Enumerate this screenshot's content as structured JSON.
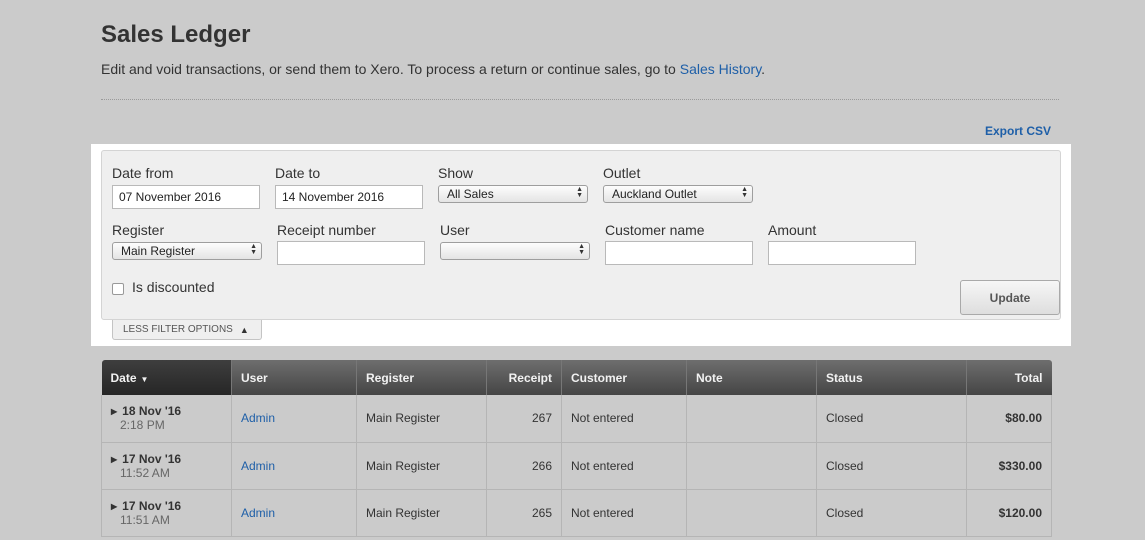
{
  "header": {
    "title": "Sales Ledger",
    "subtitle_text": "Edit and void transactions, or send them to Xero. To process a return or continue sales, go to ",
    "subtitle_link": "Sales History",
    "subtitle_end": "."
  },
  "export_csv": "Export CSV",
  "filters": {
    "date_from": {
      "label": "Date from",
      "value": "07 November 2016"
    },
    "date_to": {
      "label": "Date to",
      "value": "14 November 2016"
    },
    "show": {
      "label": "Show",
      "value": "All Sales"
    },
    "outlet": {
      "label": "Outlet",
      "value": "Auckland Outlet"
    },
    "register": {
      "label": "Register",
      "value": "Main Register"
    },
    "receipt_number": {
      "label": "Receipt number",
      "value": ""
    },
    "user": {
      "label": "User",
      "value": ""
    },
    "customer_name": {
      "label": "Customer name",
      "value": ""
    },
    "amount": {
      "label": "Amount",
      "value": ""
    },
    "is_discounted": {
      "label": "Is discounted",
      "checked": false
    },
    "update_button": "Update",
    "less_filter_options": "LESS FILTER OPTIONS"
  },
  "table": {
    "columns": [
      "Date",
      "User",
      "Register",
      "Receipt",
      "Customer",
      "Note",
      "Status",
      "Total"
    ],
    "rows": [
      {
        "date": "18 Nov '16",
        "time": "2:18 PM",
        "user": "Admin",
        "register": "Main Register",
        "receipt": "267",
        "customer": "Not entered",
        "note": "",
        "status": "Closed",
        "total": "$80.00"
      },
      {
        "date": "17 Nov '16",
        "time": "11:52 AM",
        "user": "Admin",
        "register": "Main Register",
        "receipt": "266",
        "customer": "Not entered",
        "note": "",
        "status": "Closed",
        "total": "$330.00"
      },
      {
        "date": "17 Nov '16",
        "time": "11:51 AM",
        "user": "Admin",
        "register": "Main Register",
        "receipt": "265",
        "customer": "Not entered",
        "note": "",
        "status": "Closed",
        "total": "$120.00"
      }
    ]
  },
  "icons": {
    "sort": "sort-down-icon",
    "expand": "expand-row-icon",
    "select": "select-arrows-icon",
    "collapse": "collapse-up-icon"
  },
  "colors": {
    "background": "#cbcbcb",
    "link": "#1e5fa8",
    "table_header": "#454545"
  }
}
